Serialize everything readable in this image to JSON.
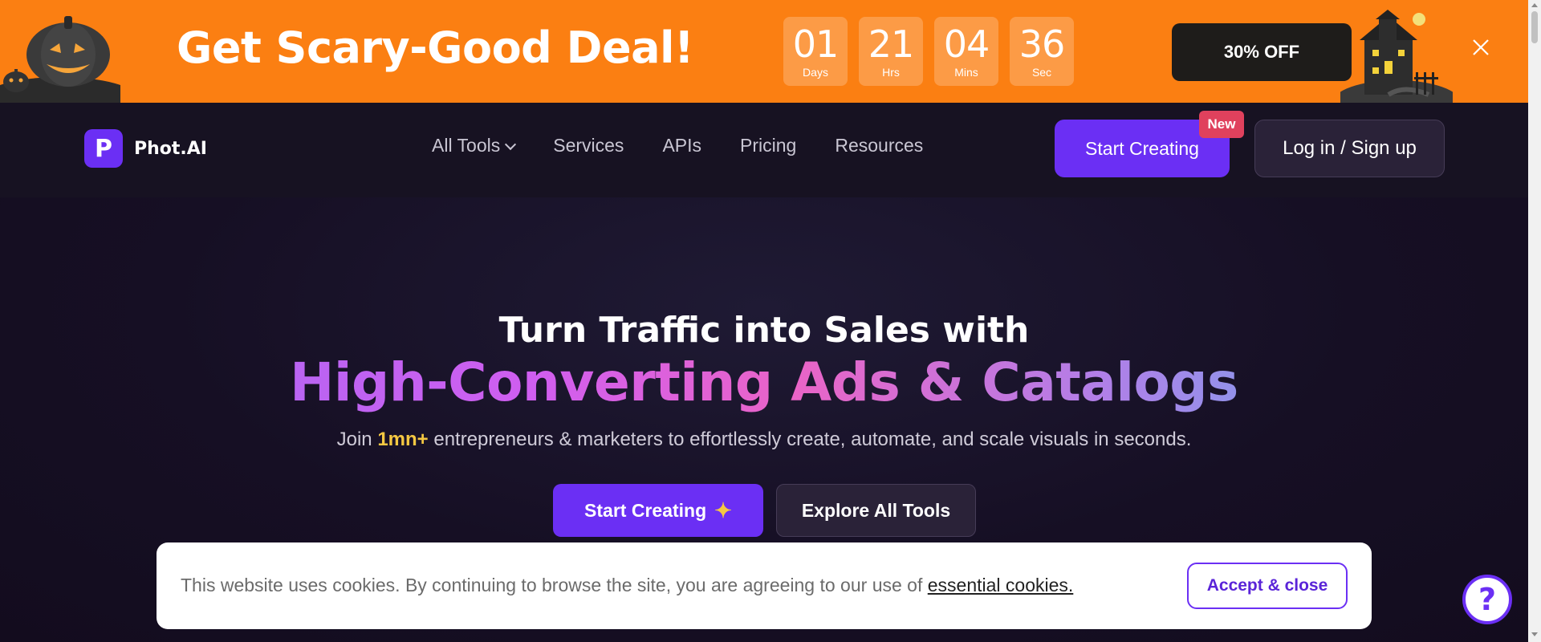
{
  "promo": {
    "title": "Get Scary-Good Deal!",
    "countdown": [
      {
        "value": "01",
        "label": "Days"
      },
      {
        "value": "21",
        "label": "Hrs"
      },
      {
        "value": "04",
        "label": "Mins"
      },
      {
        "value": "36",
        "label": "Sec"
      }
    ],
    "offer_label": "30% OFF",
    "close_icon": "close-icon",
    "background": "#fb7f12"
  },
  "navbar": {
    "logo_letter": "P",
    "logo_text": "Phot.AI",
    "links": [
      {
        "label": "All Tools",
        "has_dropdown": true
      },
      {
        "label": "Services"
      },
      {
        "label": "APIs"
      },
      {
        "label": "Pricing"
      },
      {
        "label": "Resources"
      }
    ],
    "start_label": "Start Creating",
    "new_badge": "New",
    "login_label": "Log in / Sign up",
    "accent": "#6b2ff4"
  },
  "hero": {
    "title": "Turn Traffic into Sales with",
    "highlight": "High-Converting Ads & Catalogs",
    "sub_before": "Join ",
    "sub_accent": "1mn+",
    "sub_after": " entrepreneurs & marketers to effortlessly create, automate, and scale visuals in seconds.",
    "start_label": "Start Creating",
    "explore_label": "Explore All Tools"
  },
  "cookie": {
    "text": "This website uses cookies. By continuing to browse the site, you are agreeing to our use of ",
    "link": "essential cookies.",
    "accept_label": "Accept & close"
  },
  "help": {
    "symbol": "?"
  }
}
